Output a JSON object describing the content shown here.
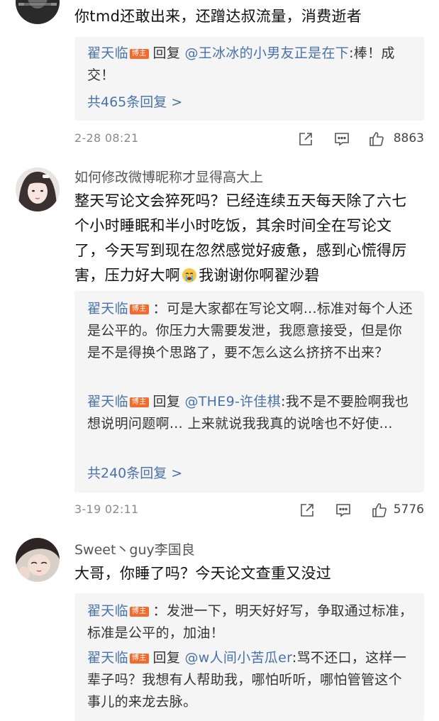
{
  "comments": [
    {
      "text": "你tmd还敢出来，还蹭达叔流量，消费逝者",
      "replies": [
        {
          "name": "翟天临",
          "badge": "博主",
          "reply_word": "回复",
          "mention": "@王冰冰的小男友正是在下",
          "text": ":棒！成交！"
        }
      ],
      "more_replies": "共465条回复 >",
      "time": "2-28 08:21",
      "likes": "8863"
    },
    {
      "username": "如何修改微博昵称才显得高大上",
      "text_before_emoji": "整天写论文会猝死吗？已经连续五天每天除了六七个小时睡眠和半小时吃饭，其余时间全在写论文了，今天写到现在忽然感觉好疲惫，感到心慌得厉害，压力好大啊",
      "text_after_emoji": "我谢谢你啊翟沙碧",
      "emoji": "crying-face",
      "replies": [
        {
          "name": "翟天临",
          "badge": "博主",
          "text": "：可是大家都在写论文啊...标准对每个人还是公平的。你压力大需要发泄，我愿意接受，但是你是不是得换个思路了，要不怎么这么挤挤不出来？"
        },
        {
          "name": "翟天临",
          "badge": "博主",
          "reply_word": "回复",
          "mention": "@THE9-许佳棋",
          "text": ":我不是不要脸啊我也想说明问题啊… 上来就说我我真的说啥也不好使..."
        }
      ],
      "more_replies": "共240条回复 >",
      "time": "3-19 02:11",
      "likes": "5776"
    },
    {
      "username": "Sweet丶guy李国良",
      "text": "大哥，你睡了吗？今天论文查重又没过",
      "replies": [
        {
          "name": "翟天临",
          "badge": "博主",
          "text": "：发泄一下，明天好好写，争取通过标准，标准是公平的，加油！"
        },
        {
          "name": "翟天临",
          "badge": "博主",
          "reply_word": "回复",
          "mention": "@w人间小苦瓜er",
          "text": ":骂不还口，这样一辈子吗？我想有人帮助我，哪怕听听，哪怕管管这个事儿的来龙去脉。"
        }
      ]
    }
  ],
  "icons": {
    "share": "share-icon",
    "comment": "comment-icon",
    "like": "thumbs-up-icon"
  },
  "colors": {
    "link": "#4a72a8",
    "badge": "#f36b2c",
    "reply_bg": "#f5f5f5",
    "meta": "#8a8a8a"
  }
}
